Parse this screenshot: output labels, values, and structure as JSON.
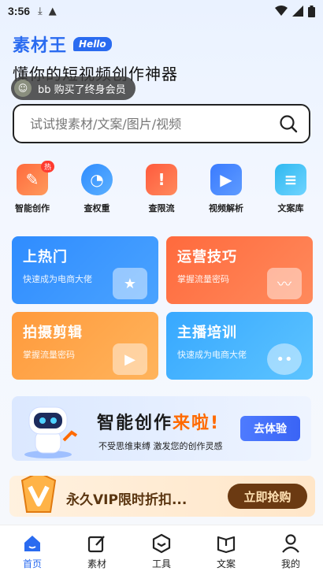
{
  "status": {
    "time": "3:56"
  },
  "brand": {
    "name": "素材王",
    "hello": "Hello",
    "slogan": "懂你的短视频创作神器"
  },
  "toast": {
    "text": "bb 购买了终身会员"
  },
  "search": {
    "placeholder": "试试搜素材/文案/图片/视频"
  },
  "tools": [
    {
      "label": "智能创作",
      "badge": "热",
      "color": "#ff6a3d"
    },
    {
      "label": "查权重",
      "color": "#2f8cff"
    },
    {
      "label": "查限流",
      "color": "#ff5a3d"
    },
    {
      "label": "视频解析",
      "color": "#3a7bff"
    },
    {
      "label": "文案库",
      "color": "#2fb8f0"
    }
  ],
  "cards": [
    {
      "title": "上热门",
      "subtitle": "快速成为电商大佬"
    },
    {
      "title": "运营技巧",
      "subtitle": "掌握流量密码"
    },
    {
      "title": "拍摄剪辑",
      "subtitle": "掌握流量密码"
    },
    {
      "title": "主播培训",
      "subtitle": "快速成为电商大佬"
    }
  ],
  "ai_banner": {
    "title_main": "智能创作",
    "title_highlight": "来啦!",
    "subtitle": "不受思维束缚 激发您的创作灵感",
    "button": "去体验"
  },
  "vip_banner": {
    "text": "永久VIP限时折扣...",
    "button": "立即抢购"
  },
  "tabbar": [
    {
      "label": "首页",
      "active": true
    },
    {
      "label": "素材"
    },
    {
      "label": "工具"
    },
    {
      "label": "文案"
    },
    {
      "label": "我的"
    }
  ]
}
